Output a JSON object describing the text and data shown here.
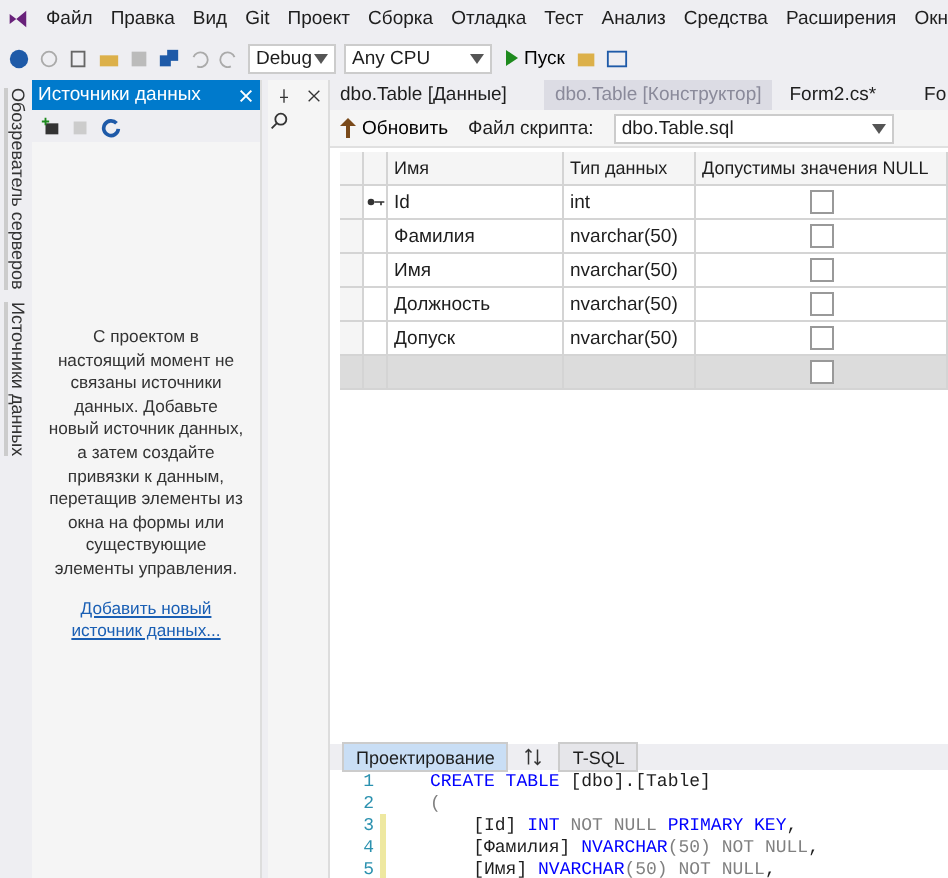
{
  "menu": [
    "Файл",
    "Правка",
    "Вид",
    "Git",
    "Проект",
    "Сборка",
    "Отладка",
    "Тест",
    "Анализ",
    "Средства",
    "Расширения",
    "Окн"
  ],
  "toolbar": {
    "configuration": "Debug",
    "platform": "Any CPU",
    "start": "Пуск"
  },
  "side_strip": [
    "Обозреватель серверов",
    "Источники данных"
  ],
  "data_sources": {
    "title": "Источники данных",
    "message": "С проектом в настоящий момент не связаны источники данных. Добавьте новый источник данных, а затем создайте привязки к данным, перетащив элементы из окна на формы или существующие элементы управления.",
    "link": "Добавить новый источник данных..."
  },
  "doc_tabs": [
    {
      "label": "dbo.Table [Данные]",
      "selected": false
    },
    {
      "label": "dbo.Table [Конструктор]",
      "selected": true
    },
    {
      "label": "Form2.cs*",
      "selected": false
    },
    {
      "label": "Fo",
      "selected": false
    }
  ],
  "designer": {
    "refresh": "Обновить",
    "script_label": "Файл скрипта:",
    "script_file": "dbo.Table.sql",
    "columns": [
      "Имя",
      "Тип данных",
      "Допустимы значения NULL"
    ],
    "rows": [
      {
        "name": "Id",
        "type": "int",
        "primary_key": true,
        "allow_null": false
      },
      {
        "name": "Фамилия",
        "type": "nvarchar(50)",
        "primary_key": false,
        "allow_null": false
      },
      {
        "name": "Имя",
        "type": "nvarchar(50)",
        "primary_key": false,
        "allow_null": false
      },
      {
        "name": "Должность",
        "type": "nvarchar(50)",
        "primary_key": false,
        "allow_null": false
      },
      {
        "name": "Допуск",
        "type": "nvarchar(50)",
        "primary_key": false,
        "allow_null": false
      }
    ],
    "new_row": {
      "allow_null": false
    }
  },
  "bottom_tabs": [
    {
      "label": "Проектирование",
      "selected": true
    },
    {
      "label": "T-SQL",
      "selected": false
    }
  ],
  "code": [
    {
      "number": "1",
      "changed": false,
      "tokens": [
        {
          "kind": "keyword",
          "text": "CREATE TABLE"
        },
        {
          "kind": "plain",
          "text": " [dbo].[Table]"
        }
      ]
    },
    {
      "number": "2",
      "changed": false,
      "tokens": [
        {
          "kind": "dim",
          "text": "("
        }
      ]
    },
    {
      "number": "3",
      "changed": true,
      "tokens": [
        {
          "kind": "plain",
          "text": "    [Id] "
        },
        {
          "kind": "keyword",
          "text": "INT"
        },
        {
          "kind": "dim",
          "text": " NOT NULL "
        },
        {
          "kind": "keyword",
          "text": "PRIMARY KEY"
        },
        {
          "kind": "plain",
          "text": ","
        }
      ]
    },
    {
      "number": "4",
      "changed": true,
      "tokens": [
        {
          "kind": "plain",
          "text": "    [Фамилия] "
        },
        {
          "kind": "keyword",
          "text": "NVARCHAR"
        },
        {
          "kind": "dim",
          "text": "(50) NOT NULL"
        },
        {
          "kind": "plain",
          "text": ","
        }
      ]
    },
    {
      "number": "5",
      "changed": true,
      "tokens": [
        {
          "kind": "plain",
          "text": "    [Имя] "
        },
        {
          "kind": "keyword",
          "text": "NVARCHAR"
        },
        {
          "kind": "dim",
          "text": "(50) NOT NULL"
        },
        {
          "kind": "plain",
          "text": ","
        }
      ]
    }
  ]
}
